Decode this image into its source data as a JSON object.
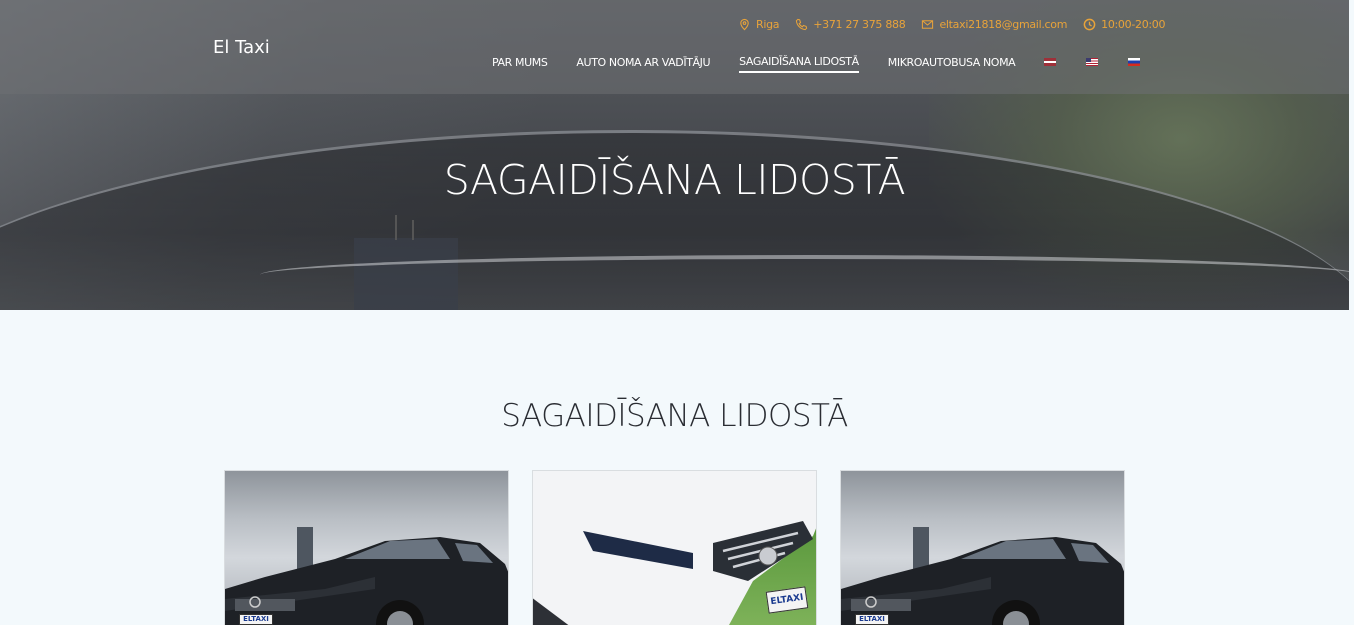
{
  "header": {
    "logo": "El Taxi",
    "contacts": [
      {
        "icon": "location-pin-icon",
        "text": "Riga"
      },
      {
        "icon": "phone-icon",
        "text": "+371 27 375 888"
      },
      {
        "icon": "email-icon",
        "text": "eltaxi21818@gmail.com"
      },
      {
        "icon": "clock-icon",
        "text": "10:00-20:00"
      }
    ],
    "nav": [
      {
        "label": "PAR MUMS"
      },
      {
        "label": "AUTO NOMA AR VADĪTĀJU"
      },
      {
        "label": "SAGAIDĪŠANA LIDOSTĀ",
        "active": true
      },
      {
        "label": "MIKROAUTOBUSA NOMA"
      }
    ],
    "languages": [
      "lv-flag",
      "en-flag",
      "ru-flag"
    ]
  },
  "hero": {
    "title": "SAGAIDĪŠANA LIDOSTĀ"
  },
  "section": {
    "title": "SAGAIDĪŠANA LIDOSTĀ"
  },
  "cards": [
    {
      "plate": "ELTAXI"
    },
    {
      "plate": "ELTAXI"
    },
    {
      "plate": "ELTAXI"
    }
  ],
  "colors": {
    "accent": "#e8a33a",
    "background": "#f3f9fc",
    "title": "#2a2d33"
  }
}
